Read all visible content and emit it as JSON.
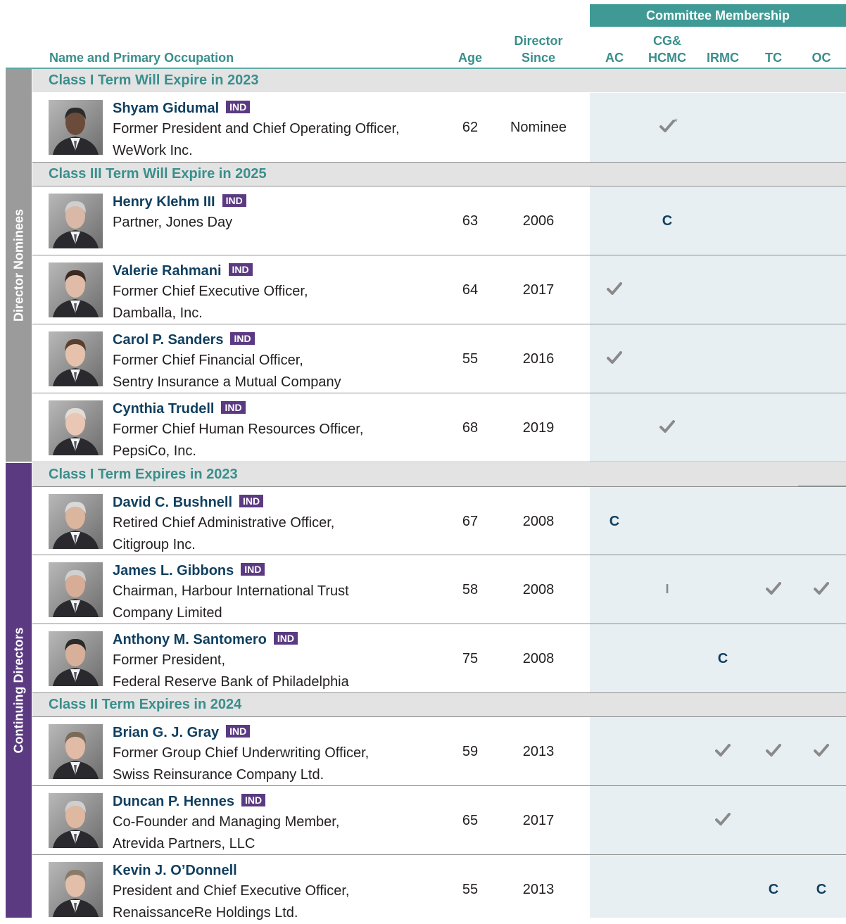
{
  "header": {
    "committee_membership": "Committee Membership",
    "name_col": "Name and Primary Occupation",
    "age_col": "Age",
    "director_col_line1": "Director",
    "director_col_line2": "Since",
    "committees": [
      {
        "line1": "",
        "line2": "AC"
      },
      {
        "line1": "CG&",
        "line2": "HCMC"
      },
      {
        "line1": "",
        "line2": "IRMC"
      },
      {
        "line1": "",
        "line2": "TC"
      },
      {
        "line1": "",
        "line2": "OC"
      }
    ]
  },
  "groups": [
    {
      "label": "Director Nominees"
    },
    {
      "label": "Continuing Directors"
    }
  ],
  "sections": [
    {
      "title": "Class I Term Will Expire in 2023"
    },
    {
      "title": "Class III Term Will Expire in 2025"
    },
    {
      "title": "Class I Term Expires in 2023"
    },
    {
      "title": "Class II Term Expires in 2024"
    }
  ],
  "independent_badge": "IND",
  "directors": [
    {
      "name": "Shyam Gidumal",
      "independent": true,
      "occupation": [
        "Former President and Chief Operating Officer,",
        "WeWork Inc."
      ],
      "age": "62",
      "since": "Nominee",
      "photo": "director-photo",
      "committees": [
        "",
        "check*",
        "",
        "",
        ""
      ]
    },
    {
      "name": "Henry Klehm III",
      "independent": true,
      "occupation": [
        "Partner, Jones Day"
      ],
      "age": "63",
      "since": "2006",
      "photo": "director-photo",
      "committees": [
        "",
        "C",
        "",
        "",
        ""
      ]
    },
    {
      "name": "Valerie Rahmani",
      "independent": true,
      "occupation": [
        "Former Chief Executive Officer,",
        "Damballa, Inc."
      ],
      "age": "64",
      "since": "2017",
      "photo": "director-photo",
      "committees": [
        "check",
        "",
        "",
        "",
        ""
      ]
    },
    {
      "name": "Carol P. Sanders",
      "independent": true,
      "occupation": [
        "Former Chief Financial Officer,",
        "Sentry Insurance a Mutual Company"
      ],
      "age": "55",
      "since": "2016",
      "photo": "director-photo",
      "committees": [
        "check",
        "",
        "",
        "",
        ""
      ]
    },
    {
      "name": "Cynthia Trudell",
      "independent": true,
      "occupation": [
        "Former Chief Human Resources Officer,",
        "PepsiCo, Inc."
      ],
      "age": "68",
      "since": "2019",
      "photo": "director-photo",
      "committees": [
        "",
        "check",
        "",
        "",
        ""
      ]
    },
    {
      "name": "David C. Bushnell",
      "independent": true,
      "occupation": [
        "Retired Chief Administrative Officer,",
        "Citigroup Inc."
      ],
      "age": "67",
      "since": "2008",
      "photo": "director-photo",
      "committees": [
        "C",
        "",
        "",
        "",
        ""
      ]
    },
    {
      "name": "James L. Gibbons",
      "independent": true,
      "occupation": [
        "Chairman, Harbour International Trust",
        "Company Limited"
      ],
      "age": "58",
      "since": "2008",
      "photo": "director-photo",
      "committees": [
        "",
        "I",
        "",
        "check",
        "check"
      ]
    },
    {
      "name": "Anthony M. Santomero",
      "independent": true,
      "occupation": [
        "Former President,",
        "Federal Reserve Bank of Philadelphia"
      ],
      "age": "75",
      "since": "2008",
      "photo": "director-photo",
      "committees": [
        "",
        "",
        "C",
        "",
        ""
      ]
    },
    {
      "name": "Brian G. J. Gray",
      "independent": true,
      "occupation": [
        "Former Group Chief Underwriting Officer,",
        "Swiss Reinsurance Company Ltd."
      ],
      "age": "59",
      "since": "2013",
      "photo": "director-photo",
      "committees": [
        "",
        "",
        "check",
        "check",
        "check"
      ]
    },
    {
      "name": "Duncan P. Hennes",
      "independent": true,
      "occupation": [
        "Co-Founder and Managing Member,",
        "Atrevida Partners, LLC"
      ],
      "age": "65",
      "since": "2017",
      "photo": "director-photo",
      "committees": [
        "",
        "",
        "check",
        "",
        ""
      ]
    },
    {
      "name": "Kevin J. O’Donnell",
      "independent": false,
      "occupation": [
        "President and Chief Executive Officer,",
        "RenaissanceRe Holdings Ltd."
      ],
      "age": "55",
      "since": "2013",
      "photo": "director-photo",
      "committees": [
        "",
        "",
        "",
        "C",
        "C"
      ]
    }
  ],
  "colors": {
    "teal": "#3f9a95",
    "navy": "#103f5f",
    "purple": "#5b3a82",
    "gray_sidebar": "#9b9b9b",
    "panel": "#e7eff2"
  }
}
